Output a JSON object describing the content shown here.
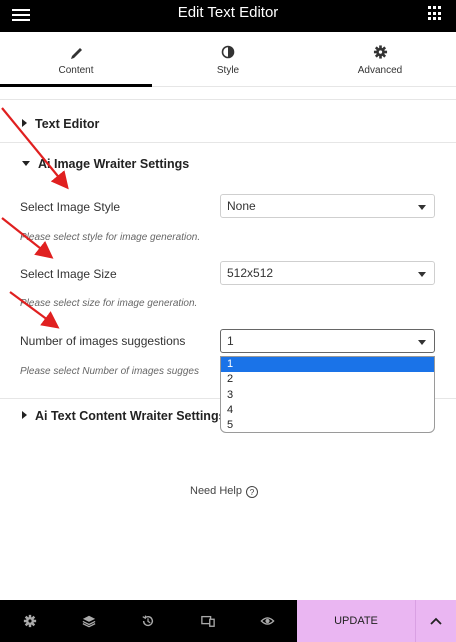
{
  "header": {
    "title": "Edit Text Editor"
  },
  "tabs": [
    {
      "label": "Content",
      "icon": "pencil-icon",
      "active": true
    },
    {
      "label": "Style",
      "icon": "half-circle-icon",
      "active": false
    },
    {
      "label": "Advanced",
      "icon": "gear-icon",
      "active": false
    }
  ],
  "sections": {
    "text_editor": "Text Editor",
    "image_settings": "Ai Image Wraiter Settings",
    "text_content_settings": "Ai Text Content Wraiter Settings"
  },
  "fields": {
    "image_style": {
      "label": "Select Image Style",
      "value": "None",
      "help": "Please select style for image generation."
    },
    "image_size": {
      "label": "Select Image Size",
      "value": "512x512",
      "help": "Please select size for image generation."
    },
    "num_suggestions": {
      "label": "Number of images suggestions",
      "value": "1",
      "help": "Please select Number of images sugges"
    }
  },
  "dropdown_options": [
    "1",
    "2",
    "3",
    "4",
    "5"
  ],
  "need_help": "Need Help",
  "need_help_icon": "?",
  "footer": {
    "update_label": "UPDATE"
  },
  "colors": {
    "accent": "#eab6f2",
    "selected_option": "#1a73e8",
    "annotation_arrow": "#e02020"
  }
}
